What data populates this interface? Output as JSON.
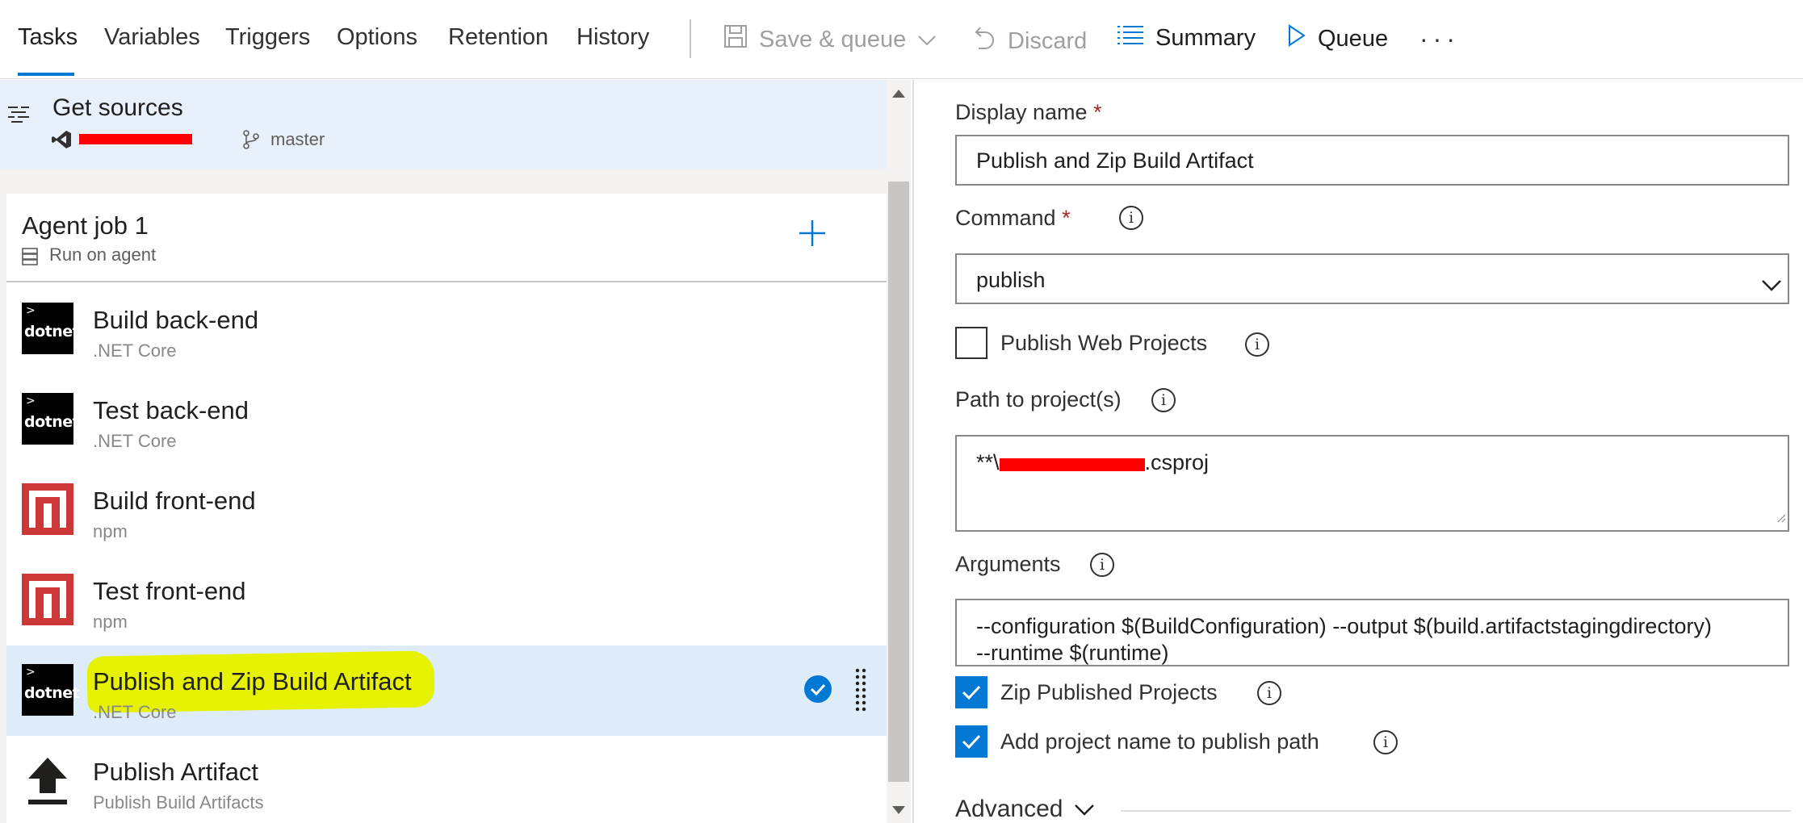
{
  "tabs": [
    {
      "label": "Tasks",
      "active": true
    },
    {
      "label": "Variables"
    },
    {
      "label": "Triggers"
    },
    {
      "label": "Options"
    },
    {
      "label": "Retention"
    },
    {
      "label": "History"
    }
  ],
  "toolbar": {
    "save_queue": "Save & queue",
    "discard": "Discard",
    "summary": "Summary",
    "queue": "Queue",
    "more": "···"
  },
  "get_sources": {
    "title": "Get sources",
    "branch": "master"
  },
  "agent_job": {
    "title": "Agent job 1",
    "subtitle": "Run on agent"
  },
  "tasks": [
    {
      "title": "Build back-end",
      "subtitle": ".NET Core",
      "icon": "dotnet"
    },
    {
      "title": "Test back-end",
      "subtitle": ".NET Core",
      "icon": "dotnet"
    },
    {
      "title": "Build front-end",
      "subtitle": "npm",
      "icon": "npm"
    },
    {
      "title": "Test front-end",
      "subtitle": "npm",
      "icon": "npm"
    },
    {
      "title": "Publish and Zip Build Artifact",
      "subtitle": ".NET Core",
      "icon": "dotnet",
      "selected": true
    },
    {
      "title": "Publish Artifact",
      "subtitle": "Publish Build Artifacts",
      "icon": "upload"
    }
  ],
  "icon_text": {
    "dotnet": "dotnet"
  },
  "form": {
    "display_name_label": "Display name",
    "display_name_value": "Publish and Zip Build Artifact",
    "required_mark": "*",
    "command_label": "Command",
    "command_value": "publish",
    "publish_web_projects_label": "Publish Web Projects",
    "publish_web_projects_checked": false,
    "path_label": "Path to project(s)",
    "path_prefix": "**\\",
    "path_suffix": ".csproj",
    "arguments_label": "Arguments",
    "arguments_line1": "--configuration $(BuildConfiguration) --output $(build.artifactstagingdirectory)",
    "arguments_line2": "--runtime $(runtime)",
    "zip_label": "Zip Published Projects",
    "zip_checked": true,
    "add_project_label": "Add project name to publish path",
    "add_project_checked": true,
    "advanced_label": "Advanced",
    "info_glyph": "i"
  },
  "colors": {
    "accent": "#0078d4",
    "selected_bg": "#deecf9",
    "highlight": "#e6f200",
    "redaction": "#ff0000",
    "npm_red": "#cb3837"
  }
}
